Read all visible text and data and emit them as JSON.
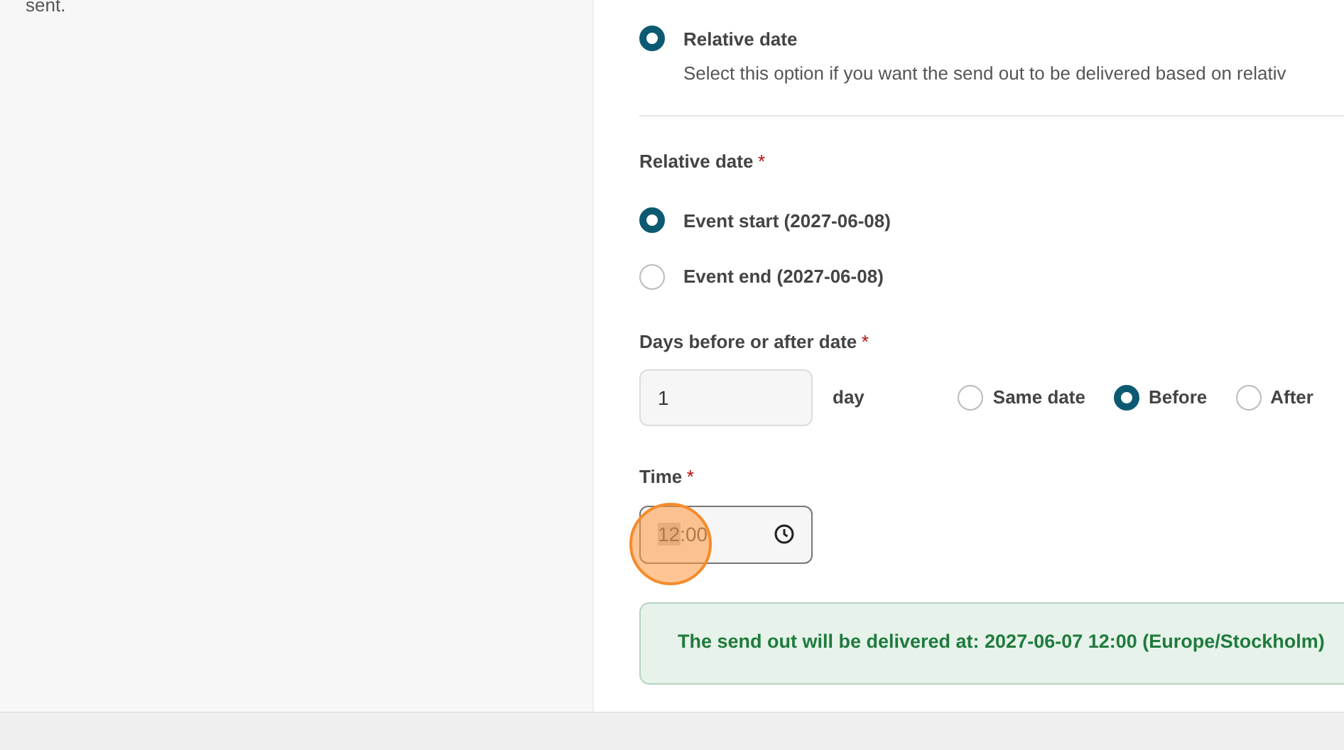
{
  "sidebar": {
    "text": "sent."
  },
  "delivery_option": {
    "label": "Relative date",
    "description": "Select this option if you want the send out to be delivered based on relativ",
    "selected": true
  },
  "relative_date": {
    "label": "Relative date",
    "required_mark": "*",
    "options": [
      {
        "label": "Event start (2027-06-08)",
        "selected": true
      },
      {
        "label": "Event end (2027-06-08)",
        "selected": false
      }
    ]
  },
  "days": {
    "label": "Days before or after date",
    "required_mark": "*",
    "value": "1",
    "unit": "day",
    "direction": [
      {
        "label": "Same date",
        "selected": false
      },
      {
        "label": "Before",
        "selected": true
      },
      {
        "label": "After",
        "selected": false
      }
    ]
  },
  "time": {
    "label": "Time",
    "required_mark": "*",
    "hours": "12",
    "separator": ":",
    "minutes": "00",
    "hours_selected": true,
    "click_highlight": true
  },
  "summary": {
    "text": "The send out will be delivered at: 2027-06-07 12:00 (Europe/Stockholm)"
  }
}
